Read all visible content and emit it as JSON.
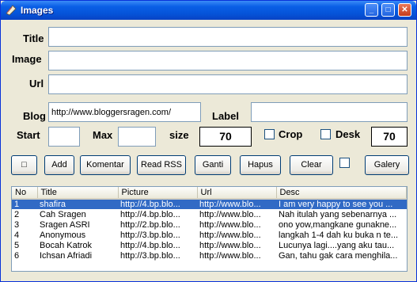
{
  "window": {
    "title": "Images",
    "minimize": "_",
    "maximize": "□",
    "close": "✕"
  },
  "labels": {
    "title": "Title",
    "image": "Image",
    "url": "Url",
    "blog": "Blog",
    "label": "Label",
    "start": "Start",
    "max": "Max",
    "size": "size",
    "crop": "Crop",
    "desk": "Desk"
  },
  "fields": {
    "title": "",
    "image": "",
    "url": "",
    "blog": "http://www.bloggersragen.com/",
    "label": "",
    "start": "",
    "max": "",
    "size": "70",
    "desk_size": "70"
  },
  "buttons": {
    "square": "□",
    "add": "Add",
    "komentar": "Komentar",
    "read_rss": "Read RSS",
    "ganti": "Ganti",
    "hapus": "Hapus",
    "clear": "Clear",
    "galery": "Galery"
  },
  "table": {
    "headers": [
      "No",
      "Title",
      "Picture",
      "Url",
      "Desc"
    ],
    "rows": [
      [
        "1",
        "shafira",
        "http://4.bp.blo...",
        "http://www.blo...",
        "I am very happy to see you ..."
      ],
      [
        "2",
        "Cah Sragen",
        "http://4.bp.blo...",
        "http://www.blo...",
        "Nah itulah yang sebenarnya ..."
      ],
      [
        "3",
        "Sragen ASRI",
        "http://2.bp.blo...",
        "http://www.blo...",
        "ono yow,mangkane gunakne..."
      ],
      [
        "4",
        "Anonymous",
        "http://3.bp.blo...",
        "http://www.blo...",
        "langkah 1-4 dah ku buka n te..."
      ],
      [
        "5",
        "Bocah Katrok",
        "http://4.bp.blo...",
        "http://www.blo...",
        "Lucunya lagi....yang aku tau..."
      ],
      [
        "6",
        "Ichsan Afriadi",
        "http://3.bp.blo...",
        "http://www.blo...",
        "Gan, tahu gak cara menghila..."
      ]
    ]
  },
  "colors": {
    "titlebar": "#0553d8",
    "selection": "#316ac5",
    "face": "#ece9d8"
  }
}
